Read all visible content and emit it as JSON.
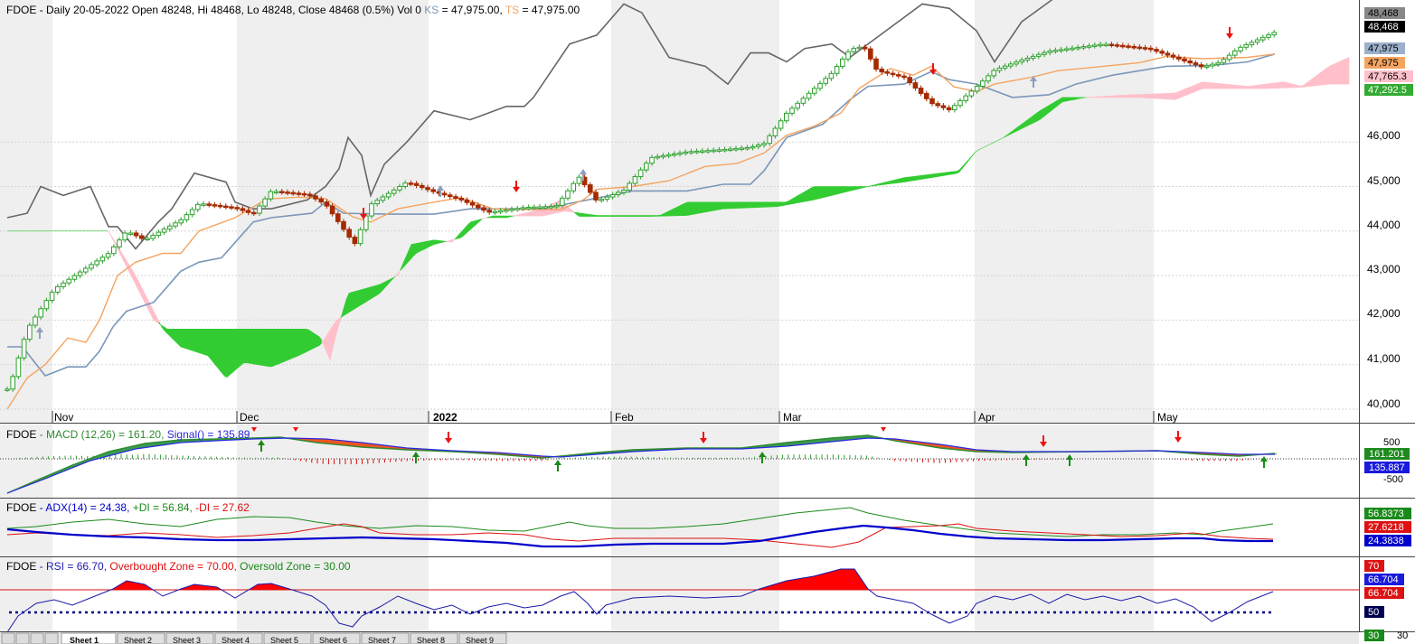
{
  "colors": {
    "bull_body": "#ffffff",
    "bull_outline": "#2ea02e",
    "bear_body": "#a52a00",
    "kumo_bull": "#33cc33",
    "kumo_bear": "#ffc0cb",
    "kijun": "#7a97b8",
    "tenkan": "#f4a460",
    "chikou": "#666666",
    "macd_line": "#2e8b2e",
    "signal_line": "#2a2adf",
    "adx_line": "#0000cc",
    "plus_di": "#1a8a1a",
    "minus_di": "#dd1111",
    "rsi_line": "#1a1aaa",
    "rsi_fill": "#ff0000",
    "grid": "#d4d4d4",
    "shade": "#efefef"
  },
  "main": {
    "header": {
      "symbol": "FDOE",
      "info": " - Daily 20-05-2022 Open 48248, Hi 48468, Lo 48248, Close 48468 (0.5%) Vol 0 ",
      "ks_label": "KS",
      "ks_value": " = 47,975.00, ",
      "ts_label": "TS",
      "ts_value": " = 47,975.00"
    },
    "y_ticks": [
      "46,000",
      "45,000",
      "44,000",
      "43,000",
      "42,000",
      "41,000",
      "40,000"
    ],
    "x_labels": [
      "Nov",
      "Dec",
      "2022",
      "Feb",
      "Mar",
      "Apr",
      "May"
    ],
    "price_badges": {
      "last_top": "48,468",
      "last_close": "48,468",
      "kijun": "47,975",
      "tenkan": "47,975",
      "span_b": "47,765.3",
      "span_a": "47,292.5"
    }
  },
  "macd": {
    "header": {
      "symbol": "FDOE",
      "macd_text": " - MACD (12,26) = 161.20, ",
      "signal_text": "Signal() = 135.89"
    },
    "y_ticks": [
      "500",
      "-500"
    ],
    "badges": {
      "macd": "161.201",
      "signal": "135.887"
    }
  },
  "adx": {
    "header": {
      "symbol": "FDOE",
      "adx_text": " - ADX(14) = 24.38, ",
      "plus_text": "+DI = 56.84, ",
      "minus_text": "-DI = 27.62"
    },
    "badges": {
      "plus_di": "56.8373",
      "minus_di": "27.6218",
      "adx": "24.3838"
    }
  },
  "rsi": {
    "header": {
      "symbol": "FDOE",
      "rsi_text": " - RSI = 66.70, ",
      "ob_text": "Overbought Zone = 70.00, ",
      "os_text": "Oversold Zone = 30.00"
    },
    "badges": {
      "ob": "70",
      "rsi_a": "66.704",
      "rsi_b": "66.704",
      "mid": "50",
      "os": "30"
    },
    "y_tick": "30"
  },
  "tabs": [
    "Sheet 1",
    "Sheet 2",
    "Sheet 3",
    "Sheet 4",
    "Sheet 5",
    "Sheet 6",
    "Sheet 7",
    "Sheet 8",
    "Sheet 9"
  ],
  "chart_data": [
    {
      "type": "candlestick",
      "title": "FDOE - Daily 20-05-2022 Open 48248, Hi 48468, Lo 48248, Close 48468 (0.5%) Vol 0",
      "ylim": [
        39750,
        48750
      ],
      "x_labels": [
        "Nov",
        "Dec",
        "2022",
        "Feb",
        "Mar",
        "Apr",
        "May"
      ],
      "last_close": 48468,
      "kijun_sen": 47975,
      "tenkan_sen": 47975,
      "senkou_span_a": 47292.5,
      "senkou_span_b": 47765.3,
      "closes_sampled": [
        40450,
        41800,
        42700,
        43500,
        44000,
        43800,
        44250,
        44620,
        44520,
        44380,
        44900,
        44820,
        44600,
        43700,
        44600,
        45100,
        44880,
        44700,
        44420,
        44530,
        44560,
        45220,
        44670,
        44920,
        45650,
        45780,
        45830,
        45880,
        45970,
        46650,
        47550,
        48080,
        48150,
        47600,
        47450,
        46870,
        46720,
        47240,
        47620,
        47840,
        48040,
        48200,
        48100,
        47680,
        47800,
        48110,
        48468
      ],
      "grid": true
    },
    {
      "type": "line",
      "title": "FDOE - MACD (12,26) = 161.20, Signal() = 135.89",
      "series": [
        {
          "name": "MACD (12,26)",
          "last": 161.2
        },
        {
          "name": "Signal()",
          "last": 135.89
        }
      ],
      "y_ticks": [
        500,
        -500
      ],
      "ylim": [
        -800,
        500
      ]
    },
    {
      "type": "line",
      "title": "FDOE - ADX(14) = 24.38, +DI = 56.84, -DI = 27.62",
      "series": [
        {
          "name": "ADX(14)",
          "last": 24.38
        },
        {
          "name": "+DI",
          "last": 56.84
        },
        {
          "name": "-DI",
          "last": 27.62
        }
      ],
      "ylim": [
        10,
        65
      ]
    },
    {
      "type": "line",
      "title": "FDOE - RSI = 66.70, Overbought Zone = 70.00, Oversold Zone = 30.00",
      "series": [
        {
          "name": "RSI",
          "last": 66.7
        }
      ],
      "overbought": 70,
      "oversold": 30,
      "ylim": [
        28,
        92
      ]
    }
  ]
}
